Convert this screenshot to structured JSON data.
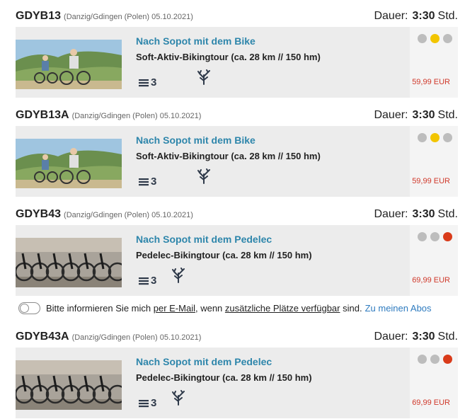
{
  "tours": [
    {
      "code": "GDYB13",
      "meta": "(Danzig/Gdingen (Polen) 05.10.2021)",
      "duration_label": "Dauer:",
      "duration_value": "3:30",
      "duration_unit": "Std.",
      "title": "Nach Sopot mit dem Bike",
      "subtitle": "Soft-Aktiv-Bikingtour (ca. 28 km // 150 hm)",
      "level": "3",
      "price": "59,99 EUR",
      "difficulty": [
        "grey",
        "yellow",
        "grey"
      ],
      "image": "bike-coast-photo"
    },
    {
      "code": "GDYB13A",
      "meta": "(Danzig/Gdingen (Polen) 05.10.2021)",
      "duration_label": "Dauer:",
      "duration_value": "3:30",
      "duration_unit": "Std.",
      "title": "Nach Sopot mit dem Bike",
      "subtitle": "Soft-Aktiv-Bikingtour (ca. 28 km // 150 hm)",
      "level": "3",
      "price": "59,99 EUR",
      "difficulty": [
        "grey",
        "yellow",
        "grey"
      ],
      "image": "bike-coast-photo"
    },
    {
      "code": "GDYB43",
      "meta": "(Danzig/Gdingen (Polen) 05.10.2021)",
      "duration_label": "Dauer:",
      "duration_value": "3:30",
      "duration_unit": "Std.",
      "title": "Nach Sopot mit dem Pedelec",
      "subtitle": "Pedelec-Bikingtour (ca. 28 km // 150 hm)",
      "level": "3",
      "price": "69,99 EUR",
      "difficulty": [
        "grey",
        "grey",
        "red"
      ],
      "image": "pedelec-row-photo"
    },
    {
      "code": "GDYB43A",
      "meta": "(Danzig/Gdingen (Polen) 05.10.2021)",
      "duration_label": "Dauer:",
      "duration_value": "3:30",
      "duration_unit": "Std.",
      "title": "Nach Sopot mit dem Pedelec",
      "subtitle": "Pedelec-Bikingtour (ca. 28 km // 150 hm)",
      "level": "3",
      "price": "69,99 EUR",
      "difficulty": [
        "grey",
        "grey",
        "red"
      ],
      "image": "pedelec-row-photo"
    }
  ],
  "notify": {
    "text_1": "Bitte informieren Sie mich ",
    "link_email": "per E-Mail",
    "text_2": ", wenn ",
    "link_places": "zusätzliche Plätze verfügbar",
    "text_3": " sind.",
    "link_abos": "Zu meinen Abos",
    "toggle_on": false
  },
  "colors": {
    "title_blue": "#2e86ab",
    "price_red": "#d0392b",
    "dot_yellow": "#f2c500",
    "dot_red": "#d93b1a",
    "dot_grey": "#bdbdbd"
  }
}
